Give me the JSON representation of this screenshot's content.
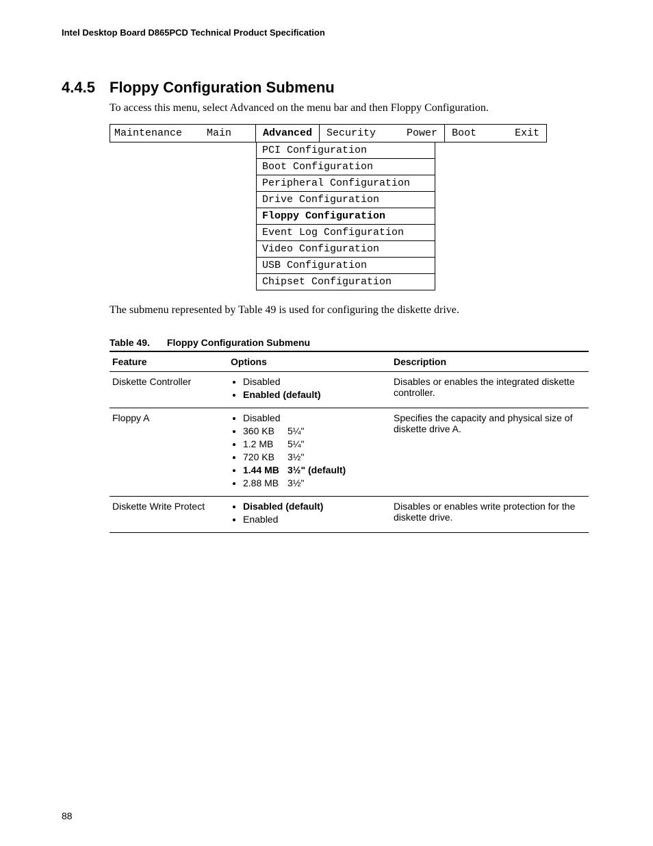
{
  "header": "Intel Desktop Board D865PCD Technical Product Specification",
  "page_number": "88",
  "section": {
    "number": "4.4.5",
    "title": "Floppy Configuration Submenu"
  },
  "intro_text": "To access this menu, select Advanced on the menu bar and then Floppy Configuration.",
  "bios_menu": {
    "leading": [
      "Maintenance",
      "Main"
    ],
    "active": "Advanced",
    "active_right": [
      "Security",
      "Power"
    ],
    "trailing": [
      "Boot",
      "Exit"
    ],
    "submenu": [
      "PCI Configuration",
      "Boot Configuration",
      "Peripheral Configuration",
      "Drive Configuration",
      "Floppy Configuration",
      "Event Log Configuration",
      "Video Configuration",
      "USB Configuration",
      "Chipset Configuration"
    ]
  },
  "after_menu_text": "The submenu represented by Table 49 is used for configuring the diskette drive.",
  "table": {
    "number": "Table 49.",
    "title": "Floppy Configuration Submenu",
    "headers": [
      "Feature",
      "Options",
      "Description"
    ],
    "rows": [
      {
        "feature": "Diskette Controller",
        "options": [
          {
            "label": "Disabled",
            "bold": false
          },
          {
            "label": "Enabled (default)",
            "bold": true
          }
        ],
        "description": "Disables or enables the integrated diskette controller."
      },
      {
        "feature": "Floppy A",
        "options": [
          {
            "label": "Disabled",
            "bold": false
          },
          {
            "label": "360 KB",
            "detail": "5¼\"",
            "bold": false
          },
          {
            "label": "1.2 MB",
            "detail": "5¼\"",
            "bold": false
          },
          {
            "label": "720 KB",
            "detail": "3½\"",
            "bold": false
          },
          {
            "label": "1.44 MB",
            "detail": "3½\" (default)",
            "bold": true
          },
          {
            "label": "2.88 MB",
            "detail": "3½\"",
            "bold": false
          }
        ],
        "description": "Specifies the capacity and physical size of diskette drive A."
      },
      {
        "feature": "Diskette Write Protect",
        "options": [
          {
            "label": "Disabled (default)",
            "bold": true
          },
          {
            "label": "Enabled",
            "bold": false
          }
        ],
        "description": "Disables or enables write protection for the diskette drive."
      }
    ]
  }
}
